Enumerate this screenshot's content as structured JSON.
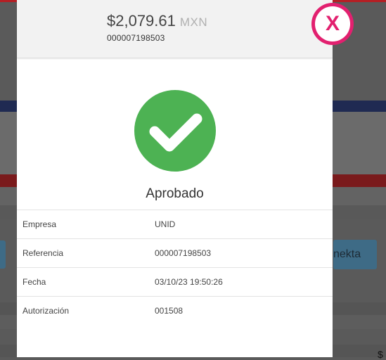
{
  "payment": {
    "amount": "$2,079.61",
    "currency": "MXN",
    "reference_number": "000007198503"
  },
  "status": {
    "label": "Aprobado",
    "icon": "check-icon",
    "color": "#4db253"
  },
  "details": [
    {
      "label": "Empresa",
      "value": "UNID"
    },
    {
      "label": "Referencia",
      "value": "000007198503"
    },
    {
      "label": "Fecha",
      "value": "03/10/23 19:50:26"
    },
    {
      "label": "Autorización",
      "value": "001508"
    }
  ],
  "close": {
    "label": "X",
    "color": "#e2206f"
  },
  "background": {
    "button_partial_label": "nekta",
    "corner_symbol": "$"
  }
}
